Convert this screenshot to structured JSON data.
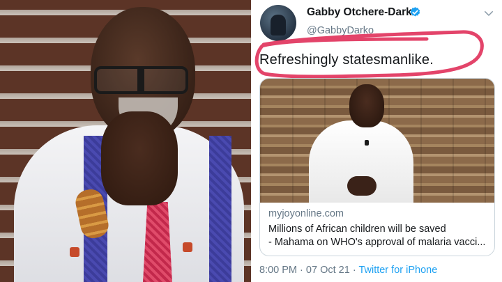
{
  "tweet": {
    "display_name": "Gabby Otchere-Darko",
    "handle": "@GabbyDarko",
    "text": "Refreshingly statesmanlike.",
    "card": {
      "domain": "myjoyonline.com",
      "title_line1": "Millions of African children will be saved",
      "title_line2": "- Mahama on WHO's approval of malaria vacci..."
    },
    "time": "8:00 PM",
    "date": "07 Oct 21",
    "separator": "·",
    "source": "Twitter for iPhone"
  },
  "icons": {
    "verified": "verified-badge-icon",
    "more": "chevron-down-icon"
  },
  "colors": {
    "highlight_stroke": "#e0305a",
    "verified_blue": "#1da1f2",
    "link_blue": "#1da1f2",
    "secondary_text": "#657786"
  }
}
